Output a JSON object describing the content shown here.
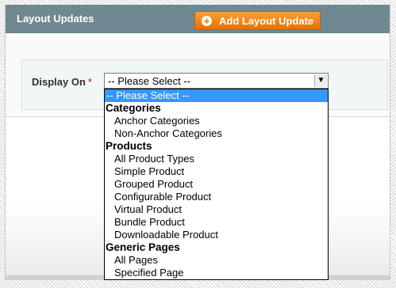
{
  "header": {
    "title": "Layout Updates",
    "add_button_icon": "plus-circle-icon",
    "add_button_label": "Add Layout Update"
  },
  "field": {
    "label": "Display On",
    "required_mark": "*",
    "selected_value": "-- Please Select --"
  },
  "dropdown": {
    "placeholder": "-- Please Select --",
    "groups": [
      {
        "label": "Categories",
        "options": [
          "Anchor Categories",
          "Non-Anchor Categories"
        ]
      },
      {
        "label": "Products",
        "options": [
          "All Product Types",
          "Simple Product",
          "Grouped Product",
          "Configurable Product",
          "Virtual Product",
          "Bundle Product",
          "Downloadable Product"
        ]
      },
      {
        "label": "Generic Pages",
        "options": [
          "All Pages",
          "Specified Page"
        ]
      }
    ]
  },
  "colors": {
    "header_bg": "#6f8992",
    "button_orange": "#ea7000",
    "selection_blue": "#3399ff",
    "required_red": "#d40707"
  }
}
